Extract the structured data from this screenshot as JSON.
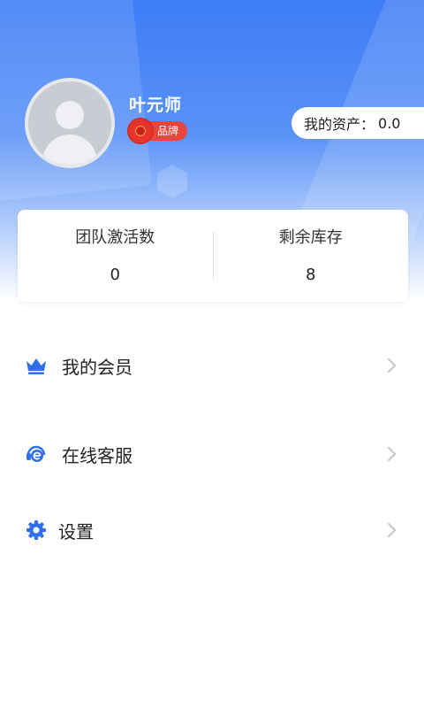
{
  "profile": {
    "name": "叶元师",
    "badge": "品牌"
  },
  "assets": {
    "label": "我的资产：",
    "value": "0.0"
  },
  "stats": [
    {
      "label": "团队激活数",
      "value": "0"
    },
    {
      "label": "剩余库存",
      "value": "8"
    }
  ],
  "menu": [
    {
      "label": "我的会员",
      "icon": "crown-icon"
    },
    {
      "label": "在线客服",
      "icon": "customer-service-icon"
    },
    {
      "label": "设置",
      "icon": "gear-icon"
    }
  ],
  "colors": {
    "header_blue": "#3d7cf6",
    "accent_blue": "#2f6fe8",
    "badge_red": "#e8453c"
  }
}
